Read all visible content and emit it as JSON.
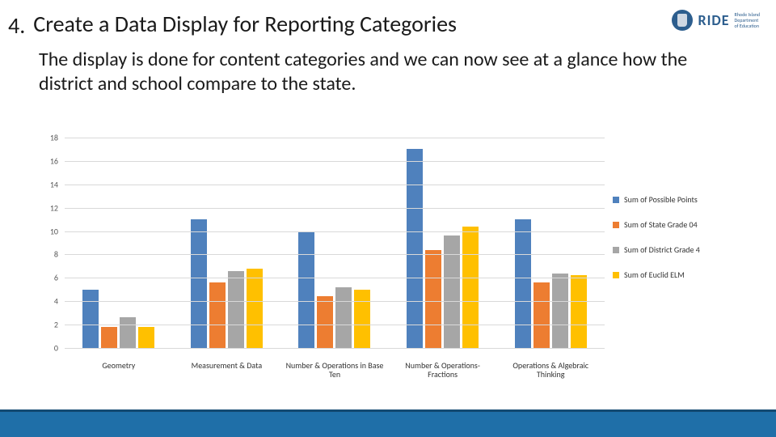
{
  "header": {
    "number": "4.",
    "title": "Create a Data Display for Reporting Categories",
    "logo_text": "RIDE",
    "logo_sub1": "Rhode Island",
    "logo_sub2": "Department",
    "logo_sub3": "of Education"
  },
  "description": "The display is done for content categories and we can now see at a glance how the district and school compare to the state.",
  "chart_data": {
    "type": "bar",
    "ylim": [
      0,
      18
    ],
    "yticks": [
      0,
      2,
      4,
      6,
      8,
      10,
      12,
      14,
      16,
      18
    ],
    "categories": [
      "Geometry",
      "Measurement & Data",
      "Number & Operations in Base Ten",
      "Number & Operations- Fractions",
      "Operations & Algebraic Thinking"
    ],
    "series": [
      {
        "name": "Sum of Possible Points",
        "color": "#4f81bd",
        "values": [
          5,
          11,
          10,
          17,
          11
        ]
      },
      {
        "name": "Sum of State Grade 04",
        "color": "#ed7d31",
        "values": [
          1.8,
          5.6,
          4.4,
          8.4,
          5.6
        ]
      },
      {
        "name": "Sum of District Grade 4",
        "color": "#a6a6a6",
        "values": [
          2.6,
          6.6,
          5.2,
          9.6,
          6.4
        ]
      },
      {
        "name": "Sum of Euclid ELM",
        "color": "#ffc000",
        "values": [
          1.8,
          6.8,
          5.0,
          10.4,
          6.2
        ]
      }
    ]
  }
}
